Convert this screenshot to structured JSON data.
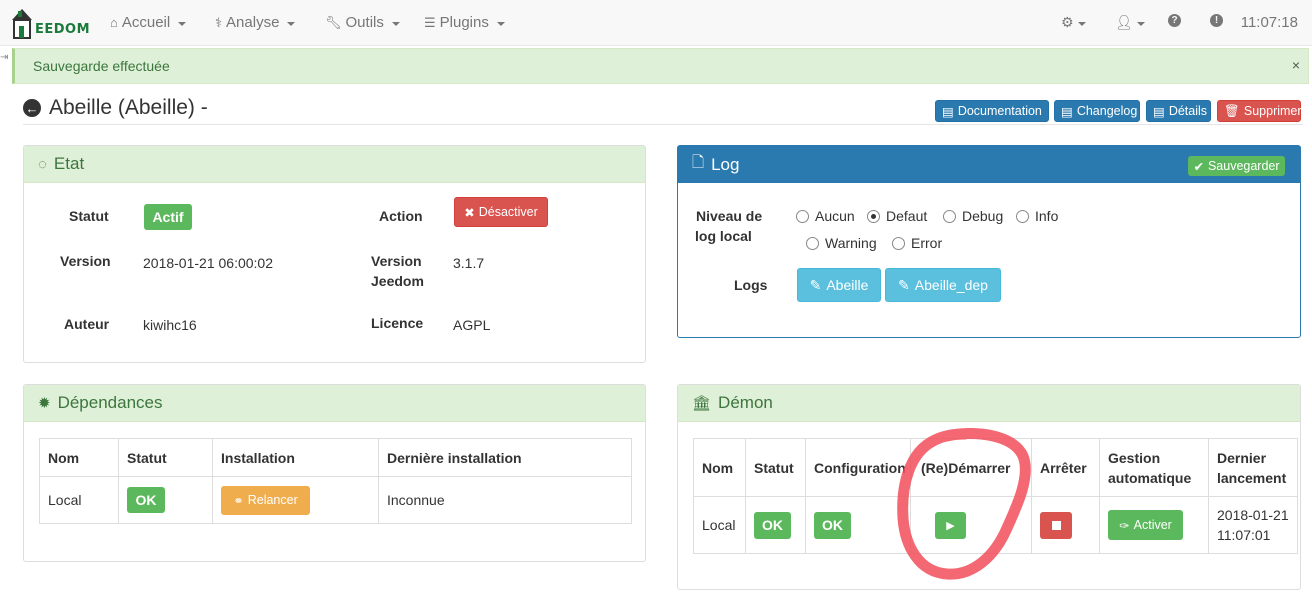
{
  "navbar": {
    "brand": "EEDOM",
    "items": [
      {
        "icon": "home-icon",
        "label": "Accueil"
      },
      {
        "icon": "stethoscope-icon",
        "label": "Analyse"
      },
      {
        "icon": "wrench-icon",
        "label": "Outils"
      },
      {
        "icon": "list-icon",
        "label": "Plugins"
      }
    ],
    "right_icons": [
      "gears-icon",
      "user-icon",
      "help-icon",
      "info-icon"
    ],
    "clock": "11:07:18"
  },
  "alert": {
    "text": "Sauvegarde effectuée",
    "close": "×"
  },
  "page": {
    "title": "Abeille (Abeille) -"
  },
  "header_buttons": {
    "documentation": "Documentation",
    "changelog": "Changelog",
    "details": "Détails",
    "supprimer": "Supprimer"
  },
  "etat": {
    "title": "Etat",
    "statut_label": "Statut",
    "statut_value": "Actif",
    "action_label": "Action",
    "action_button": "Désactiver",
    "version_label": "Version",
    "version_value": "2018-01-21 06:00:02",
    "version_jeedom_label_1": "Version",
    "version_jeedom_label_2": "Jeedom",
    "version_jeedom_value": "3.1.7",
    "auteur_label": "Auteur",
    "auteur_value": "kiwihc16",
    "licence_label": "Licence",
    "licence_value": "AGPL"
  },
  "log": {
    "title": "Log",
    "save_button": "Sauvegarder",
    "niveau_label_1": "Niveau de",
    "niveau_label_2": "log local",
    "levels": [
      "Aucun",
      "Defaut",
      "Debug",
      "Info",
      "Warning",
      "Error"
    ],
    "selected_level": "Defaut",
    "logs_label": "Logs",
    "log_buttons": [
      "Abeille",
      "Abeille_dep"
    ]
  },
  "dependances": {
    "title": "Dépendances",
    "headers": [
      "Nom",
      "Statut",
      "Installation",
      "Dernière installation"
    ],
    "row": {
      "nom": "Local",
      "statut": "OK",
      "installation": "Relancer",
      "derniere": "Inconnue"
    }
  },
  "demon": {
    "title": "Démon",
    "headers": [
      "Nom",
      "Statut",
      "Configuration",
      "(Re)Démarrer",
      "Arrêter",
      "Gestion",
      "automatique",
      "Dernier",
      "lancement"
    ],
    "row": {
      "nom": "Local",
      "statut": "OK",
      "configuration": "OK",
      "activer": "Activer",
      "dernier_1": "2018-01-21",
      "dernier_2": "11:07:01"
    }
  },
  "colors": {
    "success_bg": "#dff0d8",
    "primary": "#2a7ab0",
    "green": "#5cb85c",
    "red": "#d9534f",
    "info": "#5bc0de",
    "orange": "#f0ad4e",
    "annotation": "#f24d5a"
  }
}
